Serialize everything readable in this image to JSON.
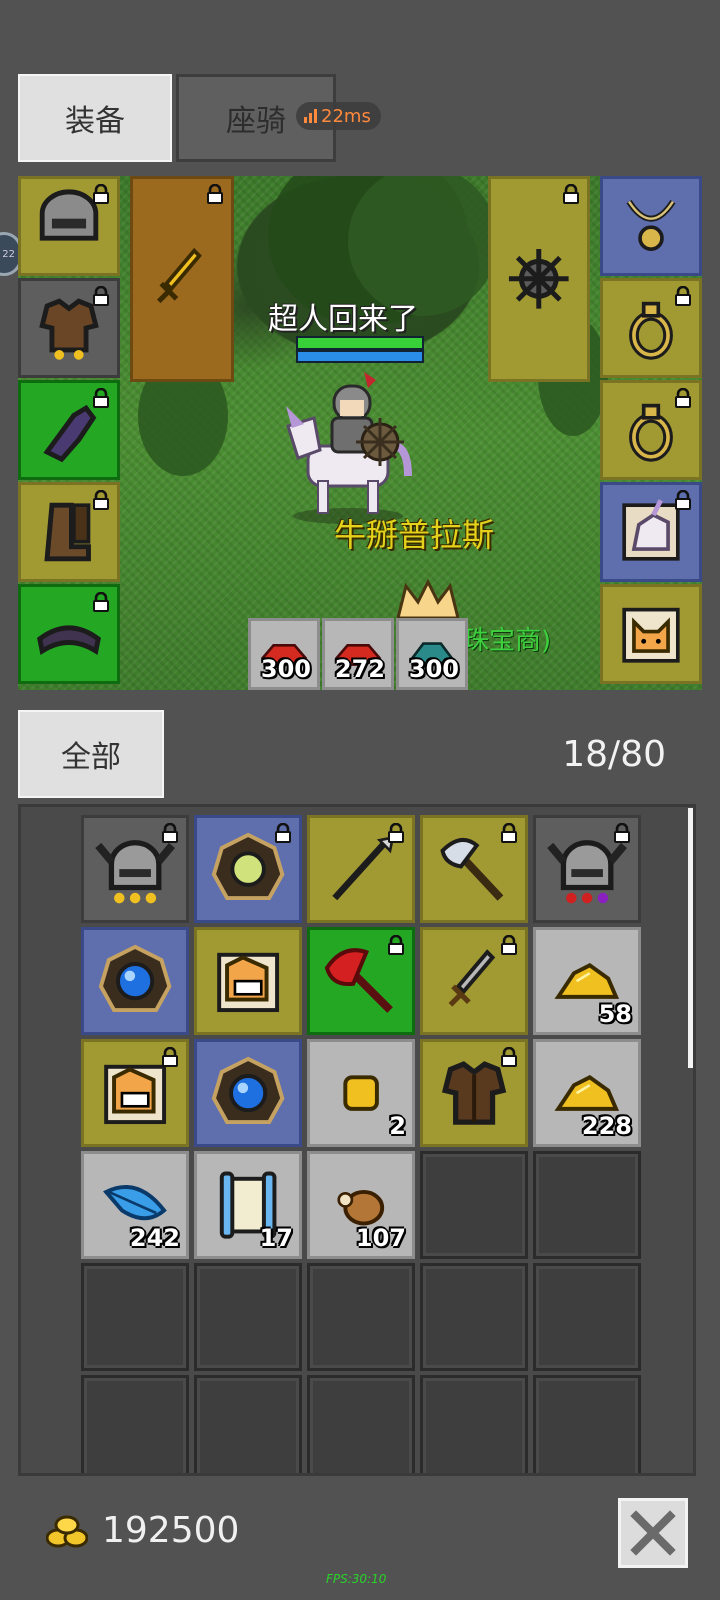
{
  "tabs": {
    "equipment": "装备",
    "mount": "座骑"
  },
  "network": {
    "ping": "22ms"
  },
  "side_badge": {
    "text": "22"
  },
  "scene": {
    "player_name": "超人回来了",
    "npc_name": "牛掰普拉斯",
    "npc_name2": "珠宝商)",
    "hp_fraction": 1.0,
    "mp_fraction": 1.0
  },
  "equipment": {
    "left_slots": [
      {
        "item": "helmet-icon",
        "color": "yellow",
        "locked": true
      },
      {
        "item": "chest-armor-icon",
        "color": "gray",
        "locked": true
      },
      {
        "item": "gloves-icon",
        "color": "green",
        "locked": true
      },
      {
        "item": "boots-icon",
        "color": "yellow",
        "locked": true
      },
      {
        "item": "belt-icon",
        "color": "green",
        "locked": true
      }
    ],
    "weapon_slot": {
      "item": "golden-sword-icon",
      "color": "orange",
      "locked": true
    },
    "offhand_slot": {
      "item": "spiked-mace-icon",
      "color": "yellow",
      "locked": true
    },
    "right_slots": [
      {
        "item": "necklace-icon",
        "color": "blue",
        "locked": false
      },
      {
        "item": "ring-icon",
        "color": "yellow",
        "locked": true
      },
      {
        "item": "ring-icon",
        "color": "yellow",
        "locked": true
      },
      {
        "item": "unicorn-mount-icon",
        "color": "blue",
        "locked": true
      },
      {
        "item": "pet-fox-icon",
        "color": "yellow",
        "locked": false
      }
    ]
  },
  "potions": [
    {
      "item": "red-potion-icon",
      "qty": "300"
    },
    {
      "item": "red-potion-icon",
      "qty": "272"
    },
    {
      "item": "blue-potion-icon",
      "qty": "300"
    }
  ],
  "inventory": {
    "filter_label": "全部",
    "count": "18/80",
    "rows": [
      [
        {
          "item": "horned-helmet-icon",
          "color": "gray",
          "locked": true,
          "qty": ""
        },
        {
          "item": "orb-amulet-icon",
          "color": "blue",
          "locked": true,
          "qty": ""
        },
        {
          "item": "spear-icon",
          "color": "yellow",
          "locked": true,
          "qty": ""
        },
        {
          "item": "axe-icon",
          "color": "yellow",
          "locked": true,
          "qty": ""
        },
        {
          "item": "horned-helmet-gems-icon",
          "color": "gray",
          "locked": true,
          "qty": ""
        }
      ],
      [
        {
          "item": "blue-gem-amulet-icon",
          "color": "blue",
          "locked": false,
          "qty": ""
        },
        {
          "item": "pet-card-icon",
          "color": "yellow",
          "locked": false,
          "qty": ""
        },
        {
          "item": "red-battle-axe-icon",
          "color": "green",
          "locked": true,
          "qty": ""
        },
        {
          "item": "short-sword-icon",
          "color": "yellow",
          "locked": true,
          "qty": ""
        },
        {
          "item": "gold-pile-icon",
          "color": "light",
          "locked": false,
          "qty": "58"
        }
      ],
      [
        {
          "item": "pet-card-icon",
          "color": "yellow",
          "locked": true,
          "qty": ""
        },
        {
          "item": "blue-gem-amulet-icon",
          "color": "blue",
          "locked": false,
          "qty": ""
        },
        {
          "item": "gold-nugget-icon",
          "color": "light",
          "locked": false,
          "qty": "2"
        },
        {
          "item": "leather-armor-icon",
          "color": "yellow",
          "locked": true,
          "qty": ""
        },
        {
          "item": "gold-pile-icon",
          "color": "light",
          "locked": false,
          "qty": "228"
        }
      ],
      [
        {
          "item": "blue-feather-icon",
          "color": "light",
          "locked": false,
          "qty": "242"
        },
        {
          "item": "scroll-icon",
          "color": "light",
          "locked": false,
          "qty": "17"
        },
        {
          "item": "meat-icon",
          "color": "light",
          "locked": false,
          "qty": "107"
        },
        {
          "item": "",
          "color": "empty",
          "locked": false,
          "qty": ""
        },
        {
          "item": "",
          "color": "empty",
          "locked": false,
          "qty": ""
        }
      ],
      [
        {
          "item": "",
          "color": "empty",
          "locked": false,
          "qty": ""
        },
        {
          "item": "",
          "color": "empty",
          "locked": false,
          "qty": ""
        },
        {
          "item": "",
          "color": "empty",
          "locked": false,
          "qty": ""
        },
        {
          "item": "",
          "color": "empty",
          "locked": false,
          "qty": ""
        },
        {
          "item": "",
          "color": "empty",
          "locked": false,
          "qty": ""
        }
      ],
      [
        {
          "item": "",
          "color": "empty",
          "locked": false,
          "qty": ""
        },
        {
          "item": "",
          "color": "empty",
          "locked": false,
          "qty": ""
        },
        {
          "item": "",
          "color": "empty",
          "locked": false,
          "qty": ""
        },
        {
          "item": "",
          "color": "empty",
          "locked": false,
          "qty": ""
        },
        {
          "item": "",
          "color": "empty",
          "locked": false,
          "qty": ""
        }
      ]
    ]
  },
  "footer": {
    "gold": "192500",
    "fps": "FPS:30:10"
  },
  "colors": {
    "background": "#525252",
    "ping": "#ff8a3d",
    "npc_name": "#e5d21a",
    "fps": "#29d429"
  }
}
